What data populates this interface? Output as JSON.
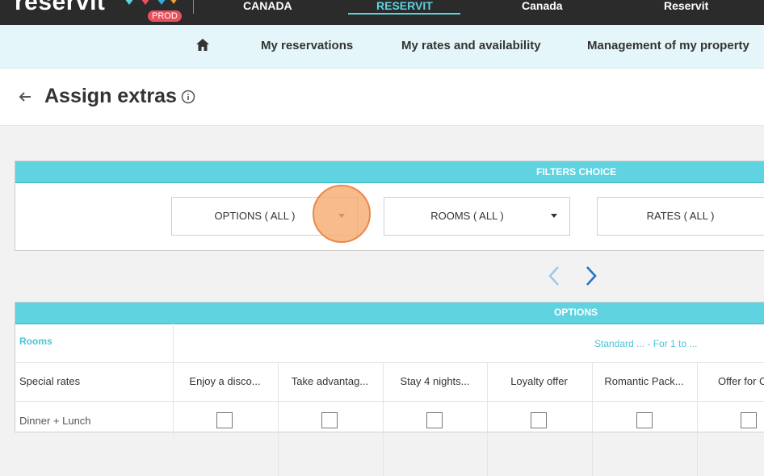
{
  "topbar": {
    "logo_text": "reservit",
    "env_badge": "PROD",
    "tabs": [
      {
        "label": "CANADA",
        "active": false
      },
      {
        "label": "RESERVIT",
        "active": true
      },
      {
        "label": "Canada",
        "active": false
      },
      {
        "label": "Reservit",
        "active": false
      }
    ]
  },
  "nav": {
    "home_icon": "home-icon",
    "items": [
      {
        "label": "My reservations"
      },
      {
        "label": "My rates and availability"
      },
      {
        "label": "Management of my property"
      }
    ]
  },
  "page": {
    "title": "Assign extras",
    "back_icon": "arrow-left-icon",
    "info_icon": "info-circle-icon"
  },
  "filters": {
    "heading": "FILTERS CHOICE",
    "dropdowns": [
      {
        "label": "OPTIONS ( ALL )"
      },
      {
        "label": "ROOMS ( ALL )"
      },
      {
        "label": "RATES ( ALL )"
      }
    ]
  },
  "options_table": {
    "heading": "OPTIONS",
    "rooms_label": "Rooms",
    "room_name": "Standard ... - For 1 to ...",
    "special_rates_label": "Special rates",
    "rates": [
      "Enjoy a disco...",
      "Take advantag...",
      "Stay 4 nights...",
      "Loyalty offer",
      "Romantic Pack...",
      "Offer for C"
    ],
    "rows": [
      {
        "label": "Dinner + Lunch"
      }
    ]
  },
  "colors": {
    "accent": "#5fd3e0",
    "topbar": "#2b2b2b",
    "navbar": "#e4f6f9",
    "highlight": "#f6aa6e",
    "pager_active": "#1a73c9",
    "pager_disabled": "#9cc8ec"
  }
}
